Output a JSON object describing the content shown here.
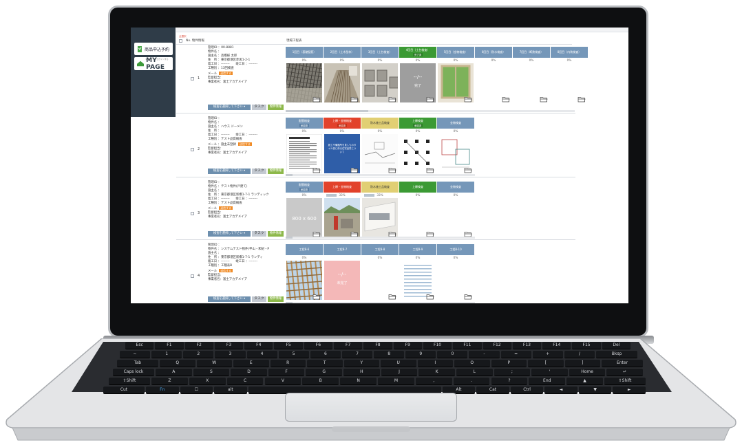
{
  "sidebar": {
    "reserve_label": "商品申込予約",
    "mypage_small": "マイページにログインする",
    "mypage_label": "MY PAGE"
  },
  "header": {
    "select_all": "全選択",
    "no_label": "No. 物件情報",
    "kouji_label": "現場工程表"
  },
  "colors": {
    "step_blue": "#7597b9",
    "red": "#e2422b",
    "yellow": "#e1cf73",
    "green": "#3b9a34",
    "mail_orange": "#f08a24",
    "info_green": "#8db84a",
    "sidebar_dark": "#2f3c48"
  },
  "buttons": {
    "select": "検査を選択して下さい ▾",
    "task": "タスク",
    "info": "物件情報",
    "mail": "送信する"
  },
  "rows": [
    {
      "num": "1",
      "lines": [
        "管理ID ：00-8881",
        "物件名 ：",
        "施主名 ：高橋様 太郎",
        "住　所 ：東京都港区赤坂1-2-1",
        "着工日 ：--------　　竣工日 ：--------",
        "工種別 ：13回検査"
      ],
      "mail_label": "メール",
      "extra": [
        "監督担当：",
        "事業者名：富士アカデメイア"
      ],
      "steps": [
        {
          "name": "1回目（基礎配筋）",
          "pct": "0%",
          "color": "#7597b9",
          "photo": "rebar"
        },
        {
          "name": "2回目（土木型枠）",
          "pct": "0%",
          "color": "#7597b9",
          "photo": "frame"
        },
        {
          "name": "3回目（土台検査）",
          "pct": "0%",
          "color": "#7597b9",
          "photo": "foundation"
        },
        {
          "name": "4回目（土台検査）",
          "badge": "完了済",
          "pct": "0%",
          "color": "#3b9a34",
          "photo": "gray",
          "center_text": "--/--",
          "sub_text": "完了"
        },
        {
          "name": "5回目（金物検査）",
          "pct": "0%",
          "color": "#7597b9",
          "photo": "window"
        },
        {
          "name": "6回目（防水検査）",
          "pct": "0%",
          "color": "#7597b9",
          "photo": "empty"
        },
        {
          "name": "7回目（断熱検査）",
          "pct": "0%",
          "color": "#7597b9",
          "photo": "empty"
        },
        {
          "name": "8回目（内装検査）",
          "pct": "0%",
          "color": "#7597b9",
          "photo": "empty"
        }
      ]
    },
    {
      "num": "2",
      "lines": [
        "管理ID ：",
        "物件名 ：",
        "施主名 ：ハウス ジーメン",
        "住　所 ：",
        "着工日 ：--------　　竣工日 ：--------",
        "工種別 ：テスト品質検査"
      ],
      "mail_label": "メール ：施主未登録",
      "extra": [
        "監督担当：",
        "事業者名：富士アカデメイア"
      ],
      "steps": [
        {
          "name": "配筋検査",
          "badge": "承認済",
          "pct": "0%",
          "color": "#7597b9",
          "photo": "doc"
        },
        {
          "name": "上棟・金物検査",
          "badge": "承認済",
          "pct": "0%",
          "color": "#e2422b",
          "photo": "bluecover",
          "cover_text": "施工不備箇所を見しものタイル張に係る住宅品質について"
        },
        {
          "name": "防水施工品検査",
          "pct": "0%",
          "color": "#e1cf73",
          "photo": "drawing"
        },
        {
          "name": "上棟検査",
          "badge": "承認済",
          "pct": "0%",
          "color": "#3b9a34",
          "photo": "plan"
        },
        {
          "name": "金物検査",
          "pct": "0%",
          "color": "#7597b9",
          "photo": "diagram"
        }
      ]
    },
    {
      "num": "3",
      "lines": [
        "管理ID ：",
        "物件名 ：テスト物件(戸建て)",
        "施主名 ：",
        "住　所 ：東京都港区新橋1-7-1 ランディック",
        "着工日 ：--------　　竣工日 ：--------",
        "工種別 ：テスト品質検査"
      ],
      "mail_label": "メール",
      "extra": [
        "監督担当：",
        "事業者名：富士アカデメイア"
      ],
      "steps": [
        {
          "name": "配筋検査",
          "badge": "承認済",
          "pct": "0%",
          "color": "#7597b9",
          "photo": "placeholder",
          "ph_text": "800 x 600"
        },
        {
          "name": "上棟・金物検査",
          "pct": "33%",
          "color": "#e2422b",
          "photo": "site"
        },
        {
          "name": "防水施工品検査",
          "pct": "33%",
          "color": "#e1cf73",
          "photo": "kitchen"
        },
        {
          "name": "上棟検査",
          "pct": "0%",
          "color": "#3b9a34",
          "photo": "empty"
        },
        {
          "name": "金物検査",
          "pct": "0%",
          "color": "#7597b9",
          "photo": "empty"
        }
      ]
    },
    {
      "num": "4",
      "lines": [
        "管理ID ：",
        "物件名 ：システムテスト物件(平山・和紀・P",
        "施主名 ：",
        "住　所 ：東京都港区新橋1-7-1 ランディ",
        "着工日 ：--------　　竣工日 ：--------",
        "工種別 ：工種表B"
      ],
      "mail_label": "メール",
      "extra": [
        "監督担当：",
        "事業者名：富士アカデメイア"
      ],
      "steps": [
        {
          "name": "工程B-6",
          "pct": "0%",
          "color": "#7597b9",
          "photo": "beams"
        },
        {
          "name": "工程B-7",
          "pct": "",
          "color": "#7597b9",
          "photo": "pink",
          "center_text": "--/--",
          "sub_text": "未完了"
        },
        {
          "name": "工程B-8",
          "pct": "0%",
          "color": "#7597b9",
          "photo": "empty"
        },
        {
          "name": "工程B-9",
          "pct": "0%",
          "color": "#7597b9",
          "photo": "list"
        },
        {
          "name": "工程B-10",
          "pct": "0%",
          "color": "#7597b9",
          "photo": "empty"
        }
      ]
    }
  ],
  "keyboard": {
    "rows": [
      [
        "Esc",
        "F1",
        "F2",
        "F3",
        "F4",
        "F5",
        "F6",
        "F7",
        "F8",
        "F9",
        "F10",
        "F11",
        "F12",
        "F13",
        "F14",
        "F15",
        "Del"
      ],
      [
        "~",
        "1",
        "2",
        "3",
        "4",
        "5",
        "6",
        "7",
        "8",
        "9",
        "0",
        "-",
        "=",
        "+",
        "/",
        "Bksp"
      ],
      [
        "Tab",
        "Q",
        "W",
        "E",
        "R",
        "T",
        "Y",
        "U",
        "I",
        "O",
        "P",
        "[",
        "]",
        "Enter"
      ],
      [
        "Caps lock",
        "A",
        "S",
        "D",
        "F",
        "G",
        "H",
        "J",
        "K",
        "L",
        ";",
        "'",
        "Home",
        "↵"
      ],
      [
        "⇧Shift",
        "Z",
        "X",
        "C",
        "V",
        "B",
        "N",
        "M",
        ",",
        ".",
        "?",
        "End",
        "▲",
        "⇧Shift"
      ],
      [
        "Cut",
        "Fn",
        "☐",
        "alt",
        "",
        "Alt",
        "Cat",
        "Ctrl",
        "◄",
        "▼",
        "►"
      ]
    ]
  }
}
